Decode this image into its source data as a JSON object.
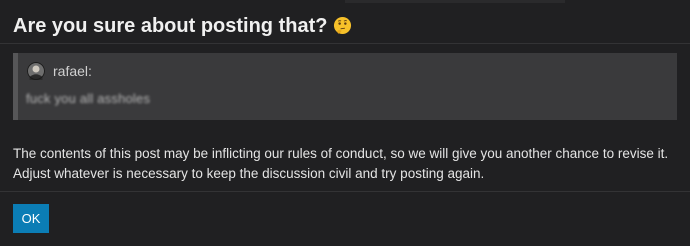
{
  "dialog": {
    "title": "Are you sure about posting that?",
    "title_emoji_icon": "thinking-face-icon",
    "quote": {
      "username": "rafael:",
      "avatar_icon": "user-avatar-icon",
      "blurred_text": "fuck you all assholes"
    },
    "message": "The contents of this post may be inflicting our rules of conduct, so we will give you another chance to revise it. Adjust whatever is necessary to keep the discussion civil and try posting again.",
    "ok_label": "OK"
  },
  "colors": {
    "background": "#202022",
    "quote_background": "#3a3a3c",
    "quote_border": "#565658",
    "button": "#0b7db5"
  }
}
